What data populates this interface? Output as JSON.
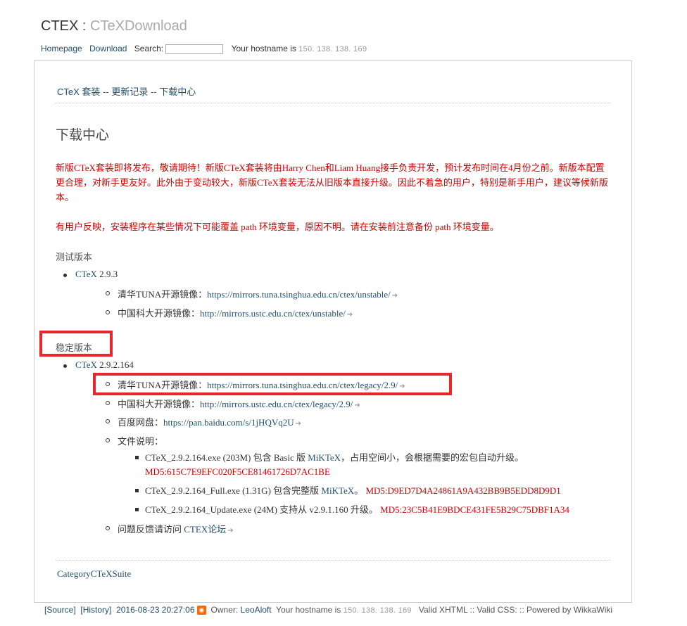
{
  "header": {
    "site": "CTEX",
    "sep": ":",
    "page": "CTeXDownload"
  },
  "navbar": {
    "homepage": "Homepage",
    "download": "Download",
    "search_label": "Search:",
    "hostname_label": "Your hostname is",
    "ip": "150. 138. 138. 169"
  },
  "breadcrumb": {
    "a": "CTeX 套装",
    "sep1": "--",
    "b": "更新记录",
    "sep2": "--",
    "c": "下载中心"
  },
  "page_title": "下载中心",
  "notice1": "新版CTeX套装即将发布，敬请期待！新版CTeX套装将由Harry Chen和Liam Huang接手负责开发，预计发布时间在4月份之前。新版本配置更合理，对新手更友好。此外由于变动较大，新版CTeX套装无法从旧版本直接升级。因此不着急的用户，特别是新手用户，建议等候新版本。",
  "notice2": "有用户反映，安装程序在某些情况下可能覆盖 path 环境变量，原因不明。请在安装前注意备份 path 环境变量。",
  "test": {
    "heading": "测试版本",
    "name": "CTeX",
    "version": "2.9.3",
    "tuna_label": "清华TUNA开源镜像：",
    "tuna_url": "https://mirrors.tuna.tsinghua.edu.cn/ctex/unstable/",
    "ustc_label": "中国科大开源镜像：",
    "ustc_url": "http://mirrors.ustc.edu.cn/ctex/unstable/"
  },
  "stable": {
    "heading": "稳定版本",
    "name": "CTeX",
    "version": "2.9.2.164",
    "tuna_label": "清华TUNA开源镜像：",
    "tuna_url": "https://mirrors.tuna.tsinghua.edu.cn/ctex/legacy/2.9/",
    "ustc_label": "中国科大开源镜像：",
    "ustc_url": "http://mirrors.ustc.edu.cn/ctex/legacy/2.9/",
    "baidu_label": "百度网盘：",
    "baidu_url": "https://pan.baidu.com/s/1jHQVq2U",
    "files_label": "文件说明：",
    "files": [
      {
        "pre": "CTeX_2.9.2.164.exe (203M) 包含 Basic 版 ",
        "link": "MiKTeX",
        "post": "，占用空间小，会根据需要的宏包自动升级。",
        "md5": "MD5:615C7E9EFC020F5CE81461726D7AC1BE"
      },
      {
        "pre": "CTeX_2.9.2.164_Full.exe (1.31G) 包含完整版 ",
        "link": "MiKTeX",
        "post": "。",
        "md5": "MD5:D9ED7D4A24861A9A432BB9B5EDD8D9D1"
      },
      {
        "pre": "CTeX_2.9.2.164_Update.exe (24M) 支持从 v2.9.1.160 升级。",
        "link": "",
        "post": "",
        "md5": "MD5:23C5B41E9BDCE431FE5B29C75DBF1A34"
      }
    ],
    "feedback_label": "问题反馈请访问",
    "feedback_link": "CTEX论坛"
  },
  "category": "CategoryCTeXSuite",
  "footer": {
    "source": "[Source]",
    "history": "[History]",
    "timestamp": "2016-08-23 20:27:06",
    "owner_label": "Owner:",
    "owner": "LeoAloft",
    "hostname_label": "Your hostname is",
    "ip": "150. 138. 138. 169",
    "valid": "Valid XHTML :: Valid CSS: :: Powered by WikkaWiki"
  },
  "icons": {
    "external": "external-link-icon",
    "rss": "rss-icon"
  },
  "colors": {
    "link": "#1f4f6e",
    "notice": "#cc0000",
    "highlight": "#e8262b"
  }
}
